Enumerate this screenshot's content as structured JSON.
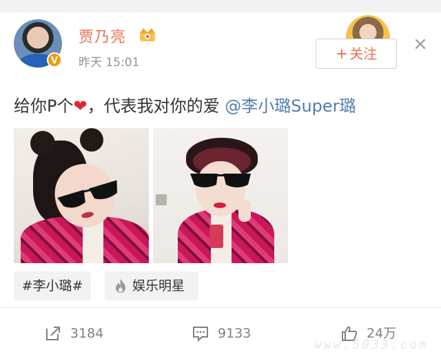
{
  "post": {
    "author": "贾乃亮",
    "verified_badge": "V",
    "time": "昨天 15:01",
    "text": "给你P个",
    "text_after_heart": "，代表我对你的爱 ",
    "mention": "@李小璐Super璐",
    "heart_glyph": "❤"
  },
  "follow_button": {
    "plus": "+",
    "label": "关注"
  },
  "close_glyph": "×",
  "tags": [
    {
      "label": "#李小璐#"
    },
    {
      "label": "娱乐明星",
      "icon": "fire-icon"
    }
  ],
  "actions": {
    "repost": {
      "icon": "repost-icon",
      "count": "3184"
    },
    "comment": {
      "icon": "comment-icon",
      "count": "9133"
    },
    "like": {
      "icon": "like-icon",
      "count": "24万"
    }
  },
  "watermark": "www.5033.com",
  "colors": {
    "accent": "#eb7350",
    "link": "#507daf",
    "muted": "#939393"
  }
}
